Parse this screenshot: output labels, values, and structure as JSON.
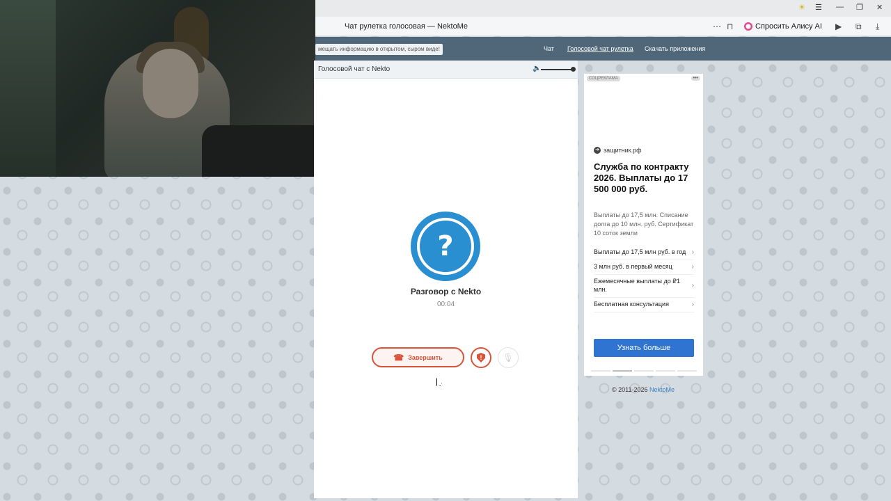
{
  "browser": {
    "tab_title": "Чат рулетка голосовая — NektoMe",
    "alice_label": "Спросить Алису AI",
    "icons": [
      "more-icon",
      "bookmark-icon",
      "alice-icon",
      "media-icon",
      "collections-icon",
      "download-icon",
      "menu-icon",
      "minimize-icon",
      "restore-icon",
      "close-icon"
    ]
  },
  "site": {
    "notice": "мещать информацию в открытом, сыром виде!",
    "nav": [
      "Чат",
      "Голосовой чат рулетка",
      "Скачать приложения"
    ]
  },
  "chat": {
    "header_title": "Голосовой чат с Nekto",
    "volume_level": 1.0,
    "avatar_glyph": "?",
    "talk_title": "Разговор с Nekto",
    "timer": "00:04",
    "end_label": "Завершить",
    "report_glyph": "!"
  },
  "ad": {
    "badge": "СОЦРЕКЛАМА",
    "more": "•••",
    "domain": "защитник.рф",
    "title": "Служба по контракту 2026. Выплаты до 17 500 000 руб.",
    "desc": "Выплаты до 17,5 млн. Списание долга до 10 млн. руб. Сертификат 10 соток земли",
    "items": [
      "Выплаты до 17,5 млн руб. в год",
      "3 млн руб. в первый месяц",
      "Ежемесячные выплаты до ₽1 млн.",
      "Бесплатная консультация"
    ],
    "cta": "Узнать больше"
  },
  "footer": {
    "copyright": "© 2011-2026",
    "brand": "NektoMe"
  },
  "colors": {
    "header": "#4f6779",
    "accent_blue": "#2a8fd0",
    "end_red": "#d9533a",
    "cta_blue": "#2f74d0"
  }
}
